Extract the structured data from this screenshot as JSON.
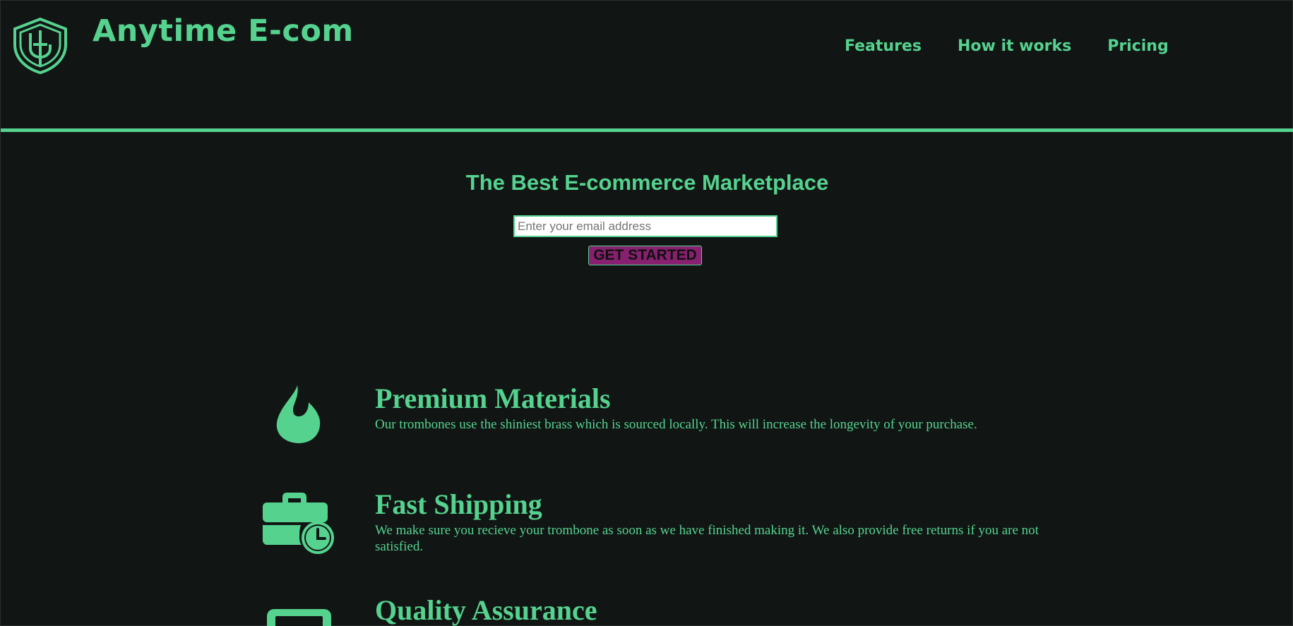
{
  "header": {
    "brand": "Anytime E-com",
    "nav": [
      {
        "label": "Features"
      },
      {
        "label": "How it works"
      },
      {
        "label": "Pricing"
      }
    ]
  },
  "hero": {
    "title": "The Best E-commerce Marketplace",
    "email_placeholder": "Enter your email address",
    "cta_label": "GET STARTED"
  },
  "features": [
    {
      "icon": "flame-icon",
      "title": "Premium Materials",
      "text": "Our trombones use the shiniest brass which is sourced locally. This will increase the longevity of your purchase."
    },
    {
      "icon": "briefcase-clock-icon",
      "title": "Fast Shipping",
      "text": "We make sure you recieve your trombone as soon as we have finished making it. We also provide free returns if you are not satisfied."
    },
    {
      "icon": "tv-icon",
      "title": "Quality Assurance",
      "text": ""
    }
  ],
  "colors": {
    "background": "#111615",
    "accent": "#55d28e",
    "cta_background": "#86206f"
  }
}
